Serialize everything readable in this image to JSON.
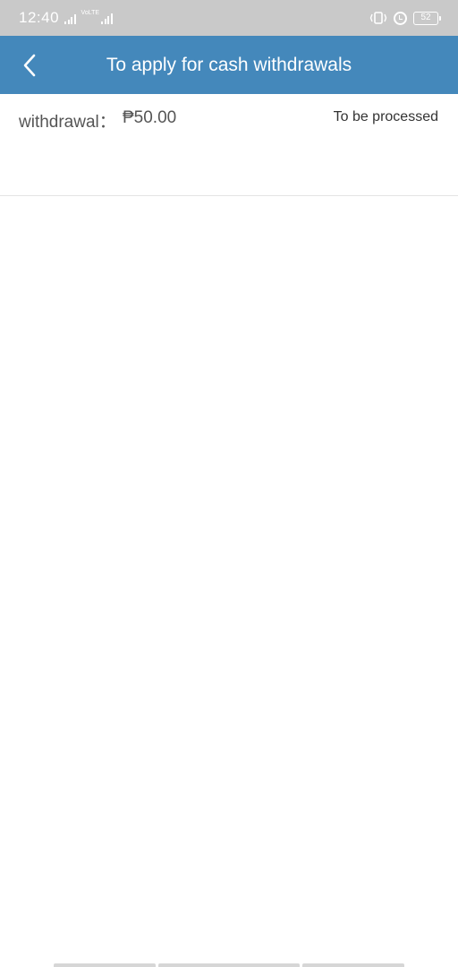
{
  "status_bar": {
    "time": "12:40",
    "sim2_label": "VoLTE",
    "battery": "52"
  },
  "header": {
    "title": "To apply for cash withdrawals"
  },
  "records": [
    {
      "label": "withdrawal：",
      "amount": "₱50.00",
      "status": "To be processed"
    }
  ],
  "colors": {
    "header_bg": "#4488bb",
    "status_bar_bg": "#c9c9c9"
  }
}
